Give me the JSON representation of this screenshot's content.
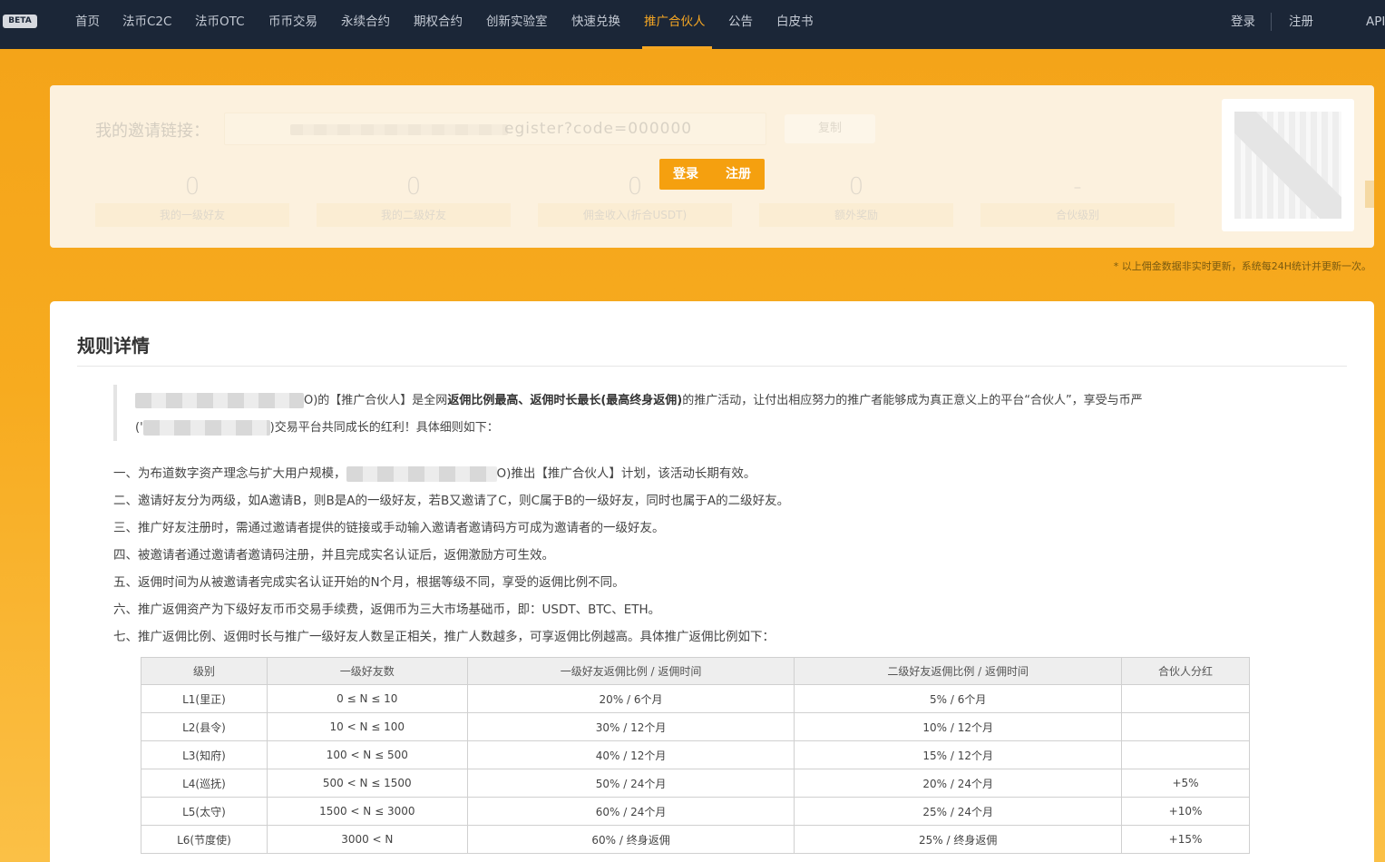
{
  "nav": {
    "beta": "BETA",
    "items": [
      "首页",
      "法币C2C",
      "法币OTC",
      "币币交易",
      "永续合约",
      "期权合约",
      "创新实验室",
      "快速兑换",
      "推广合伙人",
      "公告",
      "白皮书"
    ],
    "active_index": 8,
    "login": "登录",
    "register": "注册",
    "api": "API"
  },
  "invite": {
    "label": "我的邀请链接：",
    "link_suffix": "egister?code=000000",
    "copy": "复制",
    "login": "登录",
    "register": "注册"
  },
  "stats": [
    {
      "value": "0",
      "label": "我的一级好友"
    },
    {
      "value": "0",
      "label": "我的二级好友"
    },
    {
      "value": "0",
      "label": "佣金收入(折合USDT)"
    },
    {
      "value": "0",
      "label": "额外奖励"
    },
    {
      "value": "-",
      "label": "合伙级别"
    }
  ],
  "note": "* 以上佣金数据非实时更新，系统每24H统计并更新一次。",
  "rules": {
    "title": "规则详情",
    "intro_1a": "O)的【推广合伙人】是全网",
    "intro_1b": "返佣比例最高、返佣时长最长(最高终身返佣)",
    "intro_1c": "的推广活动，让付出相应努力的推广者能够成为真正意义上的平台“合伙人”，享受与币严",
    "intro_2a": "('",
    "intro_2b": ")交易平台共同成长的红利！具体细则如下：",
    "item_1a": "一、为布道数字资产理念与扩大用户规模，",
    "item_1b": "O)推出【推广合伙人】计划，该活动长期有效。",
    "items": [
      "二、邀请好友分为两级，如A邀请B，则B是A的一级好友，若B又邀请了C，则C属于B的一级好友，同时也属于A的二级好友。",
      "三、推广好友注册时，需通过邀请者提供的链接或手动输入邀请者邀请码方可成为邀请者的一级好友。",
      "四、被邀请者通过邀请者邀请码注册，并且完成实名认证后，返佣激励方可生效。",
      "五、返佣时间为从被邀请者完成实名认证开始的N个月，根据等级不同，享受的返佣比例不同。",
      "六、推广返佣资产为下级好友币币交易手续费，返佣币为三大市场基础币，即：USDT、BTC、ETH。",
      "七、推广返佣比例、返佣时长与推广一级好友人数呈正相关，推广人数越多，可享返佣比例越高。具体推广返佣比例如下："
    ]
  },
  "table": {
    "headers": [
      "级别",
      "一级好友数",
      "一级好友返佣比例 / 返佣时间",
      "二级好友返佣比例 / 返佣时间",
      "合伙人分红"
    ],
    "rows": [
      [
        "L1(里正)",
        "0 ≤ N ≤ 10",
        "20% / 6个月",
        "5% / 6个月",
        ""
      ],
      [
        "L2(县令)",
        "10 < N ≤ 100",
        "30% / 12个月",
        "10% / 12个月",
        ""
      ],
      [
        "L3(知府)",
        "100 < N ≤ 500",
        "40% / 12个月",
        "15% / 12个月",
        ""
      ],
      [
        "L4(巡抚)",
        "500 < N ≤ 1500",
        "50% / 24个月",
        "20% / 24个月",
        "+5%"
      ],
      [
        "L5(太守)",
        "1500 < N ≤ 3000",
        "60% / 24个月",
        "25% / 24个月",
        "+10%"
      ],
      [
        "L6(节度使)",
        "3000 < N",
        "60% / 终身返佣",
        "25% / 终身返佣",
        "+15%"
      ]
    ]
  },
  "colors": {
    "nav_bg": "#1b2637",
    "accent": "#f5a623",
    "page_bg": "#f4a318"
  }
}
